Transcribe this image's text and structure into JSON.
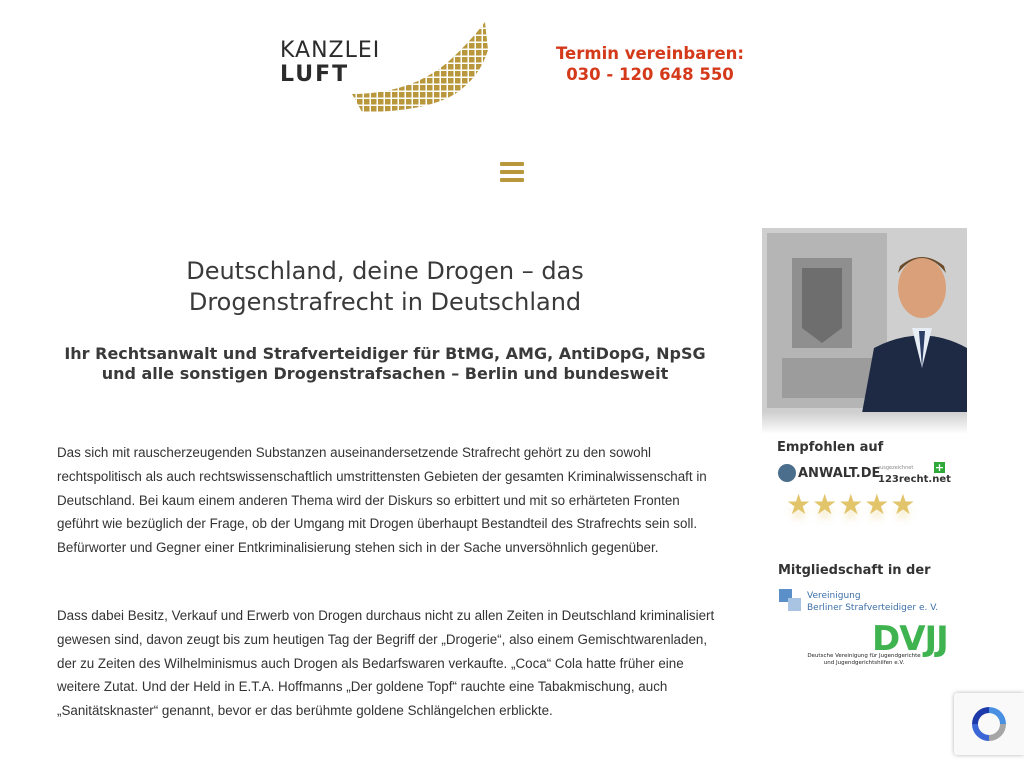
{
  "header": {
    "logo_line1": "KANZLEI",
    "logo_line2": "LUFT",
    "cta_line1": "Termin vereinbaren:",
    "cta_line2": "030 - 120 648 550"
  },
  "nav": {
    "menu_icon": "hamburger-menu-icon"
  },
  "article": {
    "title": "Deutschland, deine Drogen – das Drogenstrafrecht in Deutschland",
    "subtitle": "Ihr Rechtsanwalt und Strafverteidiger für BtMG, AMG, AntiDopG, NpSG und alle sonstigen Drogenstrafsachen – Berlin und bundesweit",
    "paragraph1": "Das sich mit rauscherzeugenden Substanzen auseinandersetzende Strafrecht gehört zu den sowohl rechtspolitisch als auch rechtswissenschaftlich umstrittensten Gebieten der gesamten Kriminalwissenschaft in Deutschland. Bei kaum einem anderen Thema wird der Diskurs so erbittert und mit so erhärteten Fronten geführt wie bezüglich der Frage, ob der Umgang mit Drogen überhaupt Bestandteil des Strafrechts sein soll. Befürworter und Gegner einer Entkriminalisierung stehen sich in der Sache unversöhnlich gegenüber.",
    "paragraph2": "Dass dabei Besitz, Verkauf und Erwerb von Drogen durchaus nicht zu allen Zeiten in Deutschland kriminalisiert gewesen sind, davon zeugt bis zum heutigen Tag der Begriff der „Drogerie“, also einem Gemischtwarenladen, der zu Zeiten des Wilhelminismus auch Drogen als Bedarfswaren verkaufte. „Coca“ Cola hatte früher eine weitere Zutat. Und der Held in E.T.A. Hoffmanns „Der goldene Topf“ rauchte eine Tabakmischung, auch „Sanitätsknaster“ genannt, bevor er das berühmte goldene Schlängelchen erblickte."
  },
  "sidebar": {
    "recommended_title": "Empfohlen auf",
    "anwalt_logo": "ANWALT.DE",
    "r123_small": "ausgezeichnet",
    "r123_logo": "123recht.net",
    "rating": 4.5,
    "stars": "★★★★★",
    "membership_title": "Mitgliedschaft in der",
    "vbs_line1": "Vereinigung",
    "vbs_line2": "Berliner Strafverteidiger e. V.",
    "dvjj_logo": "DVJJ",
    "dvjj_line1": "Deutsche Vereinigung für Jugendgerichte",
    "dvjj_line2": "und Jugendgerichtshilfen e.V."
  },
  "colors": {
    "gold": "#b8973d",
    "cta_red": "#d43a1a",
    "dvjj_green": "#3fb34f",
    "vbs_blue": "#3d6fa8"
  }
}
